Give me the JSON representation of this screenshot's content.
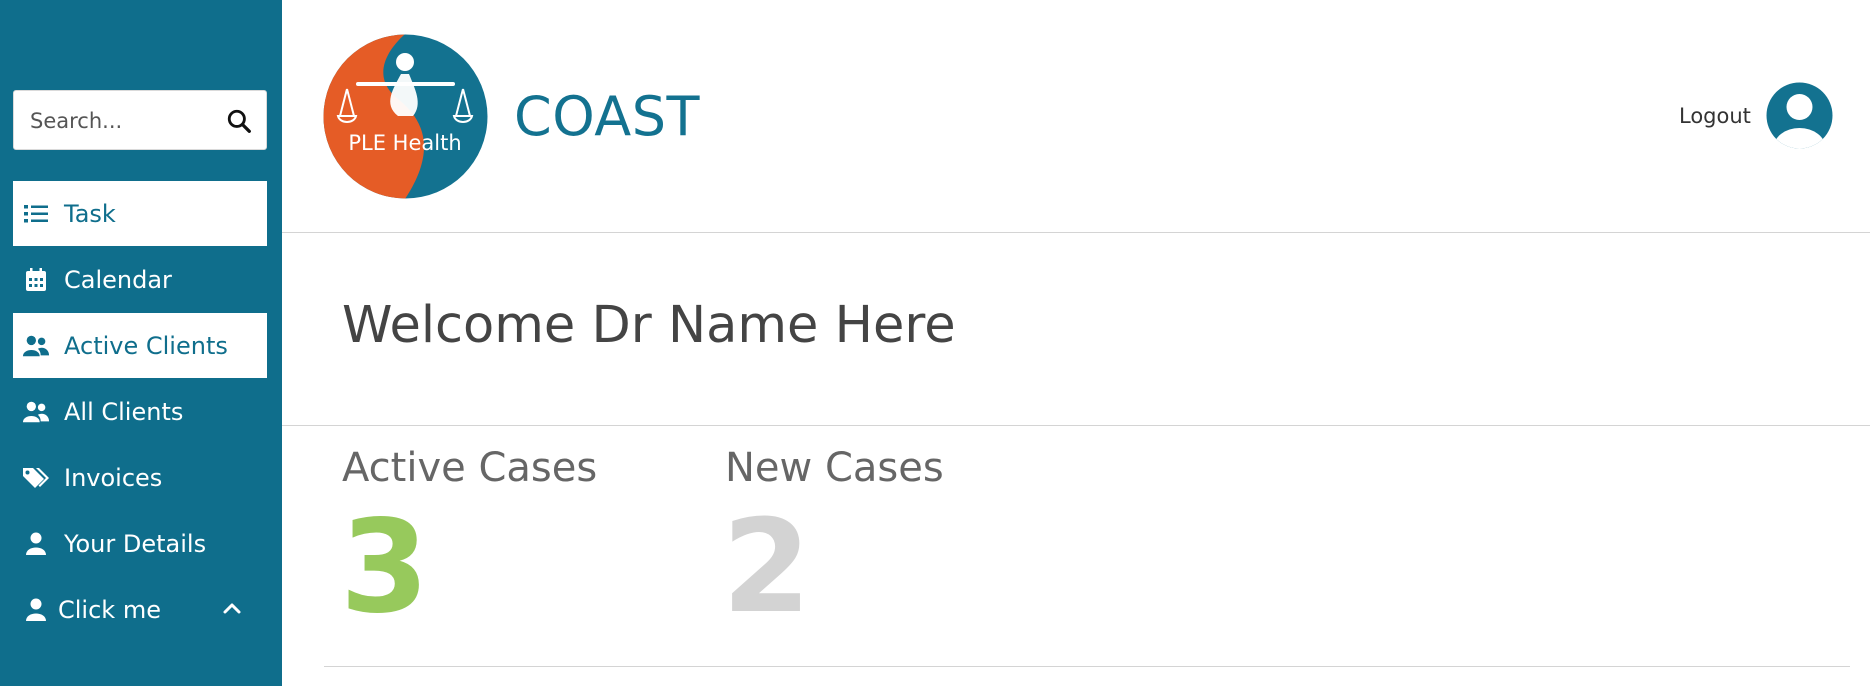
{
  "sidebar": {
    "search": {
      "placeholder": "Search..."
    },
    "items": [
      {
        "label": "Task",
        "icon": "list-icon",
        "active": true
      },
      {
        "label": "Calendar",
        "icon": "calendar-icon",
        "active": false
      },
      {
        "label": "Active Clients",
        "icon": "users-icon",
        "active": true
      },
      {
        "label": "All Clients",
        "icon": "users-icon",
        "active": false
      },
      {
        "label": "Invoices",
        "icon": "tags-icon",
        "active": false
      },
      {
        "label": "Your Details",
        "icon": "user-icon",
        "active": false
      },
      {
        "label": "Click me",
        "icon": "user-icon",
        "active": false,
        "trailing_icon": "chevron-up-icon"
      }
    ]
  },
  "header": {
    "logo_text": "PLE Health",
    "brand_name": "COAST",
    "logout_label": "Logout"
  },
  "main": {
    "welcome_text": "Welcome Dr Name Here",
    "stats": [
      {
        "label": "Active Cases",
        "value": "3",
        "color": "#97c95c"
      },
      {
        "label": "New Cases",
        "value": "2",
        "color": "#d3d3d3"
      }
    ]
  },
  "colors": {
    "sidebar_bg": "#0f6e8c",
    "brand_teal": "#137290",
    "logo_orange": "#e55c26"
  }
}
